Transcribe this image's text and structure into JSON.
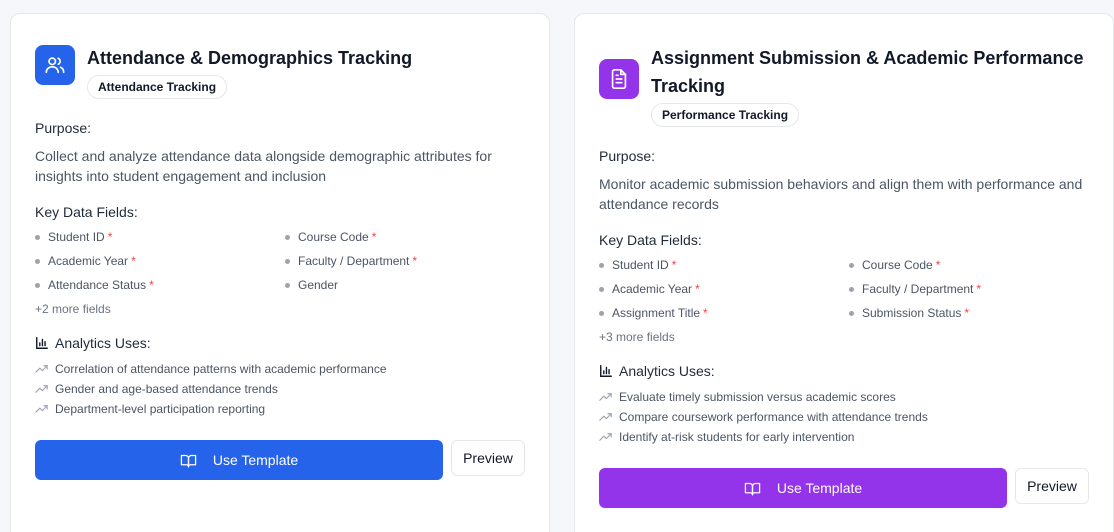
{
  "cards": [
    {
      "title_lines": [
        "Attendance & Demographics Tracking"
      ],
      "badge": "Attendance Tracking",
      "icon": "users-icon",
      "accent": "#2563eb",
      "purpose_label": "Purpose:",
      "purpose": "Collect and analyze attendance data alongside demographic attributes for insights into student engagement and inclusion",
      "fields_label": "Key Data Fields:",
      "fields": [
        {
          "label": "Student ID",
          "required": true
        },
        {
          "label": "Course Code",
          "required": true
        },
        {
          "label": "Academic Year",
          "required": true
        },
        {
          "label": "Faculty / Department",
          "required": true
        },
        {
          "label": "Attendance Status",
          "required": true
        },
        {
          "label": "Gender",
          "required": false
        }
      ],
      "required_mark": "*",
      "more_fields": "+2 more fields",
      "analytics_label": "Analytics Uses:",
      "uses": [
        "Correlation of attendance patterns with academic performance",
        "Gender and age-based attendance trends",
        "Department-level participation reporting"
      ],
      "use_button": "Use Template",
      "preview_button": "Preview"
    },
    {
      "title_lines": [
        "Assignment Submission & Academic Performance",
        "Tracking"
      ],
      "badge": "Performance Tracking",
      "icon": "document-icon",
      "accent": "#9333ea",
      "purpose_label": "Purpose:",
      "purpose": "Monitor academic submission behaviors and align them with performance and attendance records",
      "fields_label": "Key Data Fields:",
      "fields": [
        {
          "label": "Student ID",
          "required": true
        },
        {
          "label": "Course Code",
          "required": true
        },
        {
          "label": "Academic Year",
          "required": true
        },
        {
          "label": "Faculty / Department",
          "required": true
        },
        {
          "label": "Assignment Title",
          "required": true
        },
        {
          "label": "Submission Status",
          "required": true
        }
      ],
      "required_mark": "*",
      "more_fields": "+3 more fields",
      "analytics_label": "Analytics Uses:",
      "uses": [
        "Evaluate timely submission versus academic scores",
        "Compare coursework performance with attendance trends",
        "Identify at-risk students for early intervention"
      ],
      "use_button": "Use Template",
      "preview_button": "Preview"
    }
  ]
}
